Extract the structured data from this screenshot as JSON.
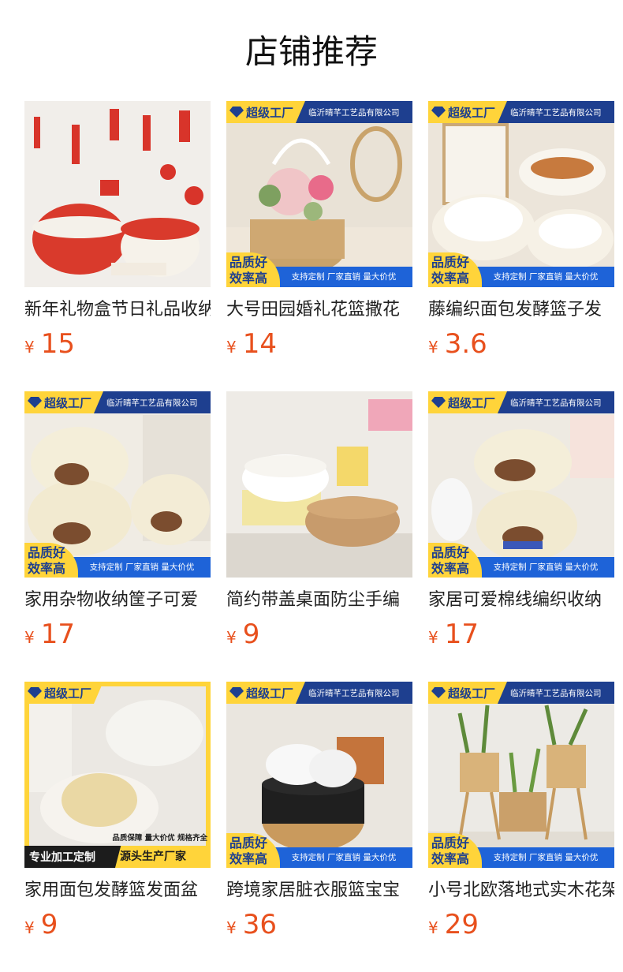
{
  "header": {
    "title": "店铺推荐"
  },
  "badges": {
    "super_factory": "超级工厂",
    "company": "临沂晴芊工艺品有限公司",
    "quality_line1": "品质好",
    "quality_line2": "效率高",
    "slogan": "支持定制 厂家直销 量大价优",
    "custom_left": "专业加工定制",
    "custom_right": "源头生产厂家",
    "guarantee": "品质保障  量大价优  规格齐全"
  },
  "colors": {
    "price": "#e8501d",
    "badge_yellow": "#ffd43a",
    "badge_blue": "#1e3f8f"
  },
  "products": [
    {
      "name": "新年礼物盒节日礼品收纳",
      "currency": "¥",
      "price": "15"
    },
    {
      "name": "大号田园婚礼花篮撒花",
      "currency": "¥",
      "price": "14"
    },
    {
      "name": "藤编织面包发酵篮子发",
      "currency": "¥",
      "price": "3.6"
    },
    {
      "name": "家用杂物收纳筐子可爱",
      "currency": "¥",
      "price": "17"
    },
    {
      "name": "简约带盖桌面防尘手编",
      "currency": "¥",
      "price": "9"
    },
    {
      "name": "家居可爱棉线编织收纳",
      "currency": "¥",
      "price": "17"
    },
    {
      "name": "家用面包发酵篮发面盆",
      "currency": "¥",
      "price": "9"
    },
    {
      "name": "跨境家居脏衣服篮宝宝",
      "currency": "¥",
      "price": "36"
    },
    {
      "name": "小号北欧落地式实木花架",
      "currency": "¥",
      "price": "29"
    }
  ]
}
